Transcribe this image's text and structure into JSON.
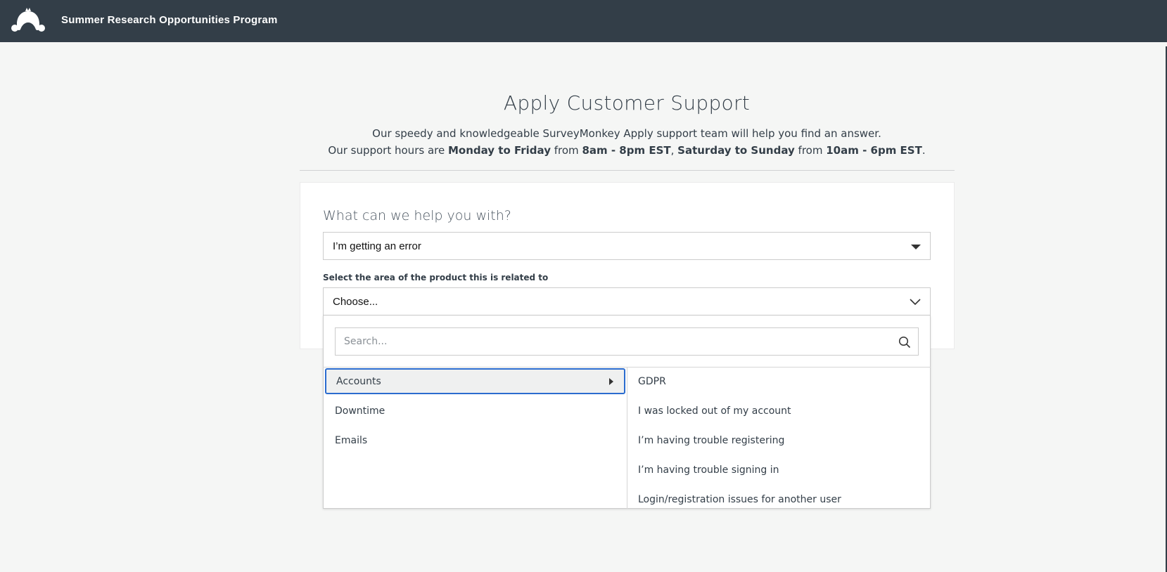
{
  "header": {
    "app_title": "Summer Research Opportunities Program",
    "logo_icon": "surveymonkey-logo-icon",
    "bg_color": "#333e48"
  },
  "support": {
    "title": "Apply Customer Support",
    "line1": "Our speedy and knowledgeable SurveyMonkey Apply support team will help you find an answer.",
    "line2_prefix": "Our support hours are ",
    "line2_days1": "Monday to Friday",
    "line2_from1": " from ",
    "line2_hours1": "8am - 8pm EST",
    "line2_sep": ", ",
    "line2_days2": "Saturday to Sunday",
    "line2_from2": " from ",
    "line2_hours2": "10am - 6pm EST",
    "line2_end": "."
  },
  "form": {
    "help_label": "What can we help you with?",
    "help_value": "I’m getting an error",
    "area_label": "Select the area of the product this is related to",
    "area_value": "Choose...",
    "dropdown": {
      "search_placeholder": "Search...",
      "categories": [
        {
          "label": "Accounts",
          "active": true
        },
        {
          "label": "Downtime",
          "active": false
        },
        {
          "label": "Emails",
          "active": false
        }
      ],
      "subitems": [
        "GDPR",
        "I was locked out of my account",
        "I’m having trouble registering",
        "I’m having trouble signing in",
        "Login/registration issues for another user"
      ]
    }
  },
  "colors": {
    "accent": "#2b6ccf",
    "page_bg": "#f5f6f5",
    "text": "#333e48"
  }
}
